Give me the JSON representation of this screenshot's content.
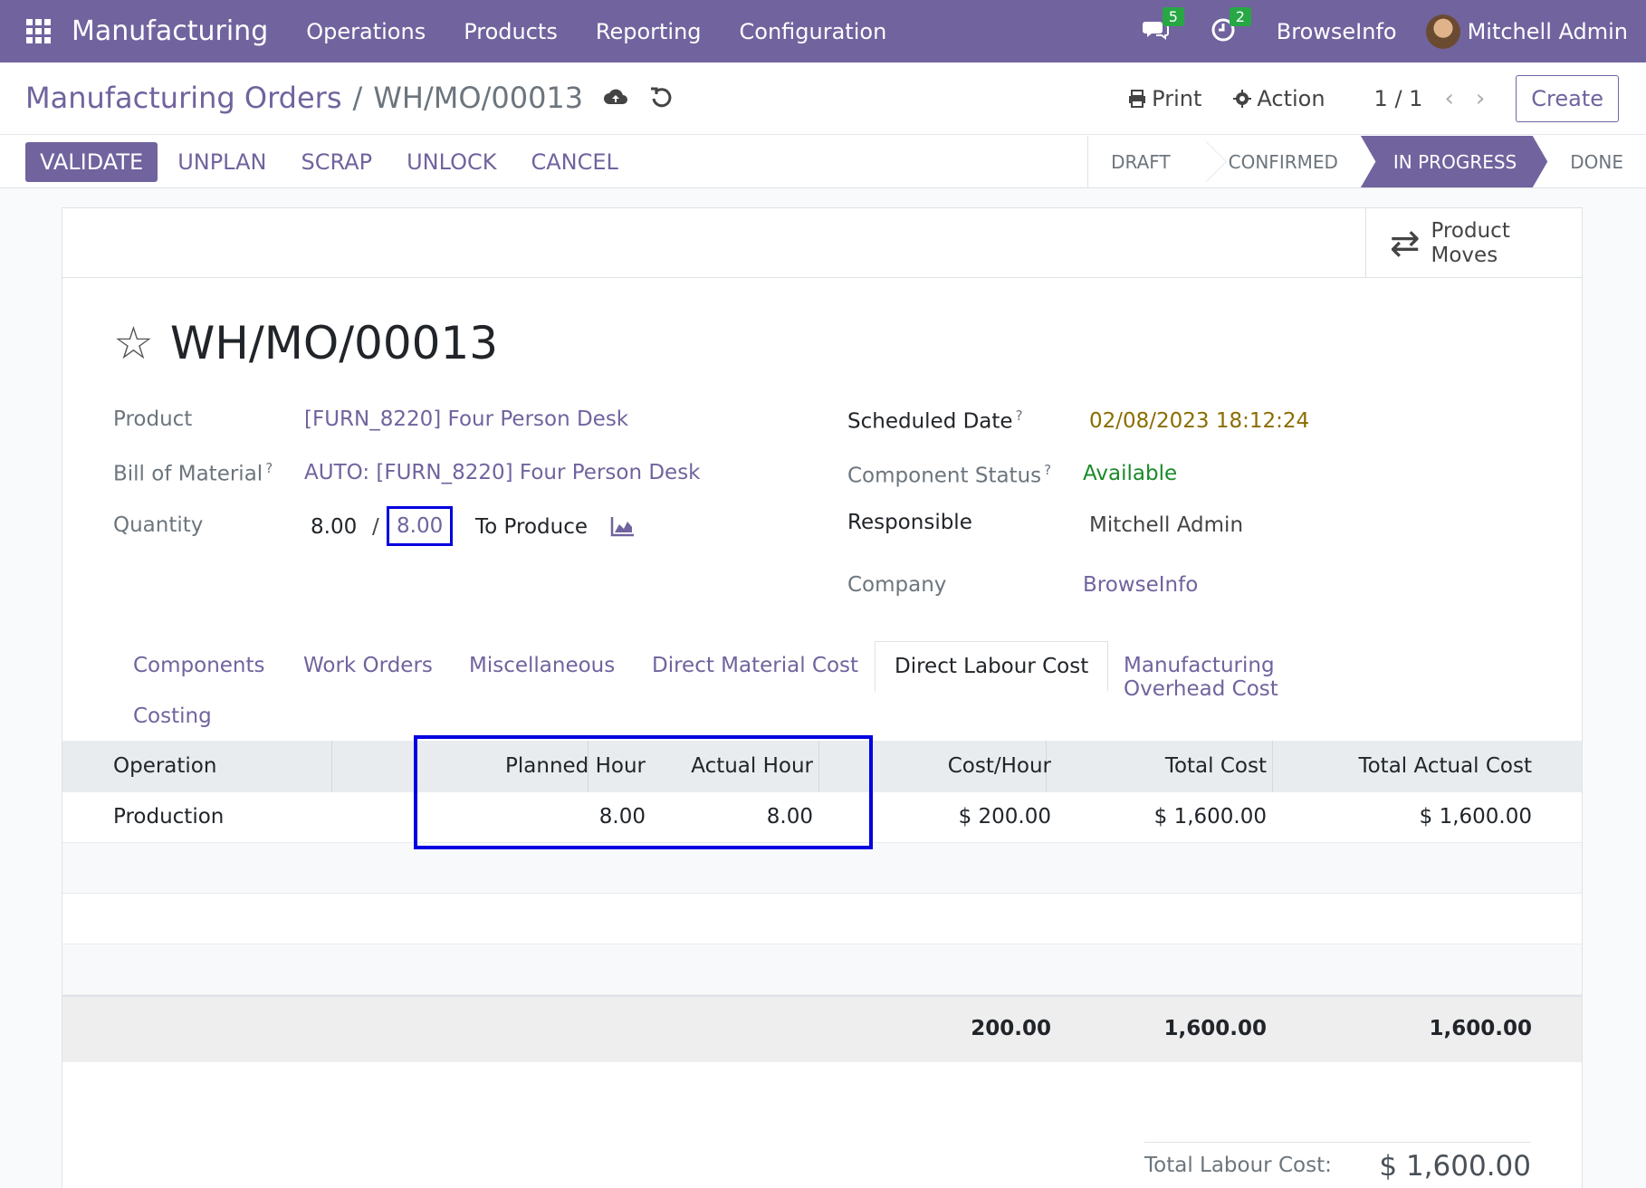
{
  "navbar": {
    "app_name": "Manufacturing",
    "menu": [
      "Operations",
      "Products",
      "Reporting",
      "Configuration"
    ],
    "messages_count": "5",
    "activities_count": "2",
    "company": "BrowseInfo",
    "user": "Mitchell Admin"
  },
  "control": {
    "breadcrumb_parent": "Manufacturing Orders",
    "breadcrumb_sep": "/",
    "breadcrumb_current": "WH/MO/00013",
    "print_label": "Print",
    "action_label": "Action",
    "pager": "1 / 1",
    "create_label": "Create"
  },
  "actions": {
    "validate": "VALIDATE",
    "unplan": "UNPLAN",
    "scrap": "SCRAP",
    "unlock": "UNLOCK",
    "cancel": "CANCEL"
  },
  "stages": [
    "DRAFT",
    "CONFIRMED",
    "IN PROGRESS",
    "DONE"
  ],
  "active_stage": "IN PROGRESS",
  "smart_button": {
    "label": "Product Moves"
  },
  "record": {
    "title": "WH/MO/00013",
    "product_label": "Product",
    "product_value": "[FURN_8220] Four Person Desk",
    "bom_label": "Bill of Material",
    "bom_value": "AUTO: [FURN_8220] Four Person Desk",
    "quantity_label": "Quantity",
    "qty_produced": "8.00",
    "qty_sep": "/",
    "qty_total": "8.00",
    "to_produce": "To Produce",
    "scheduled_label": "Scheduled Date",
    "scheduled_value": "02/08/2023 18:12:24",
    "component_label": "Component Status",
    "component_value": "Available",
    "responsible_label": "Responsible",
    "responsible_value": "Mitchell Admin",
    "company_label": "Company",
    "company_value": "BrowseInfo"
  },
  "tabs": [
    "Components",
    "Work Orders",
    "Miscellaneous",
    "Direct Material Cost",
    "Direct Labour Cost",
    "Manufacturing Overhead Cost",
    "Costing"
  ],
  "active_tab": "Direct Labour Cost",
  "table": {
    "headers": [
      "Operation",
      "Planned Hour",
      "Actual Hour",
      "Cost/Hour",
      "Total Cost",
      "Total Actual Cost"
    ],
    "rows": [
      [
        "Production",
        "8.00",
        "8.00",
        "$ 200.00",
        "$ 1,600.00",
        "$ 1,600.00"
      ]
    ],
    "footer": [
      "200.00",
      "1,600.00",
      "1,600.00"
    ]
  },
  "total_labour": {
    "label": "Total Labour Cost:",
    "value": "$ 1,600.00"
  },
  "colors": {
    "brand": "#71639e",
    "highlight": "#0000e0",
    "badge": "#28a745",
    "date": "#8a6d00",
    "available": "#1a8a2a"
  }
}
